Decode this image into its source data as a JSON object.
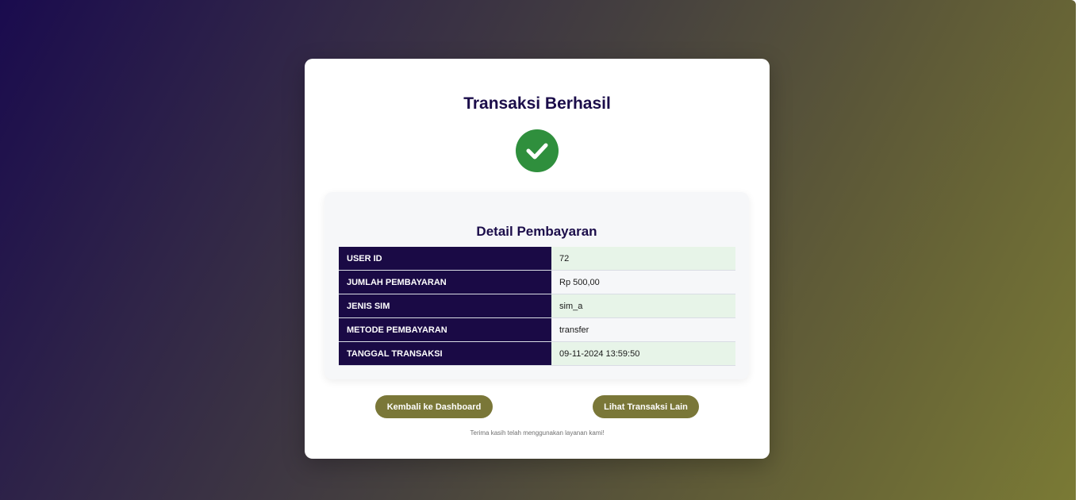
{
  "card": {
    "title": "Transaksi Berhasil",
    "status_icon": "check-circle-icon",
    "status_color": "#2f8f3d"
  },
  "detail": {
    "title": "Detail Pembayaran",
    "rows": [
      {
        "label": "USER ID",
        "value": "72"
      },
      {
        "label": "JUMLAH PEMBAYARAN",
        "value": "Rp 500,00"
      },
      {
        "label": "JENIS SIM",
        "value": "sim_a"
      },
      {
        "label": "METODE PEMBAYARAN",
        "value": "transfer"
      },
      {
        "label": "TANGGAL TRANSAKSI",
        "value": "09-11-2024 13:59:50"
      }
    ]
  },
  "actions": {
    "dashboard_label": "Kembali ke Dashboard",
    "other_label": "Lihat Transaksi Lain"
  },
  "footer": {
    "text": "Terima kasih telah menggunakan layanan kami!"
  },
  "colors": {
    "primary_dark": "#1a0a45",
    "accent_olive": "#7a7738",
    "success_green": "#2f8f3d",
    "row_highlight": "#e7f4e8"
  }
}
